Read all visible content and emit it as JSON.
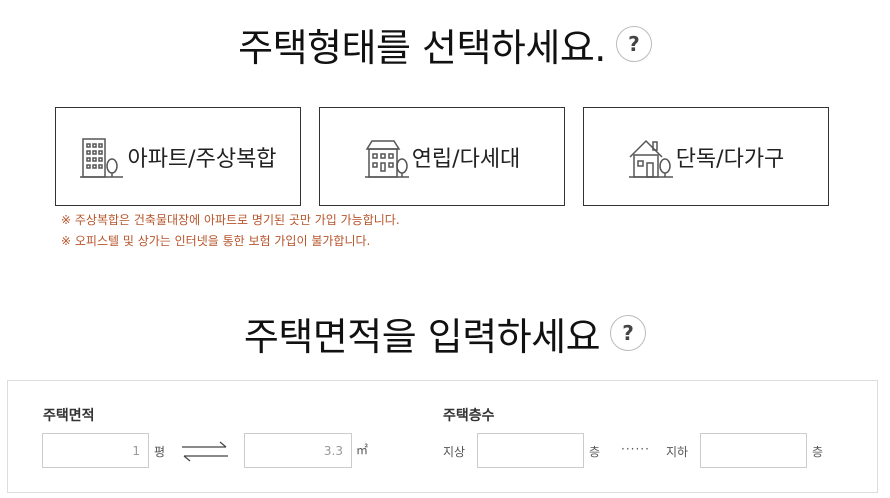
{
  "house_type": {
    "title": "주택형태를 선택하세요.",
    "help_label": "?",
    "options": [
      {
        "label": "아파트/주상복합",
        "icon": "apartment-icon"
      },
      {
        "label": "연립/다세대",
        "icon": "row-house-icon"
      },
      {
        "label": "단독/다가구",
        "icon": "detached-house-icon"
      }
    ],
    "notes": [
      "※ 주상복합은 건축물대장에 아파트로 명기된 곳만 가입 가능합니다.",
      "※ 오피스텔 및 상가는 인터넷을 통한 보험 가입이 불가합니다."
    ]
  },
  "house_area": {
    "title": "주택면적을 입력하세요",
    "help_label": "?",
    "area_label": "주택면적",
    "pyeong_value": "1",
    "pyeong_unit": "평",
    "sqm_value": "3.3",
    "sqm_unit": "㎡",
    "floors_label": "주택층수",
    "above_label": "지상",
    "above_value": "",
    "above_unit": "층",
    "separator": "······",
    "below_label": "지하",
    "below_value": "",
    "below_unit": "층"
  },
  "colors": {
    "note_text": "#b7542a",
    "border": "#333333"
  }
}
